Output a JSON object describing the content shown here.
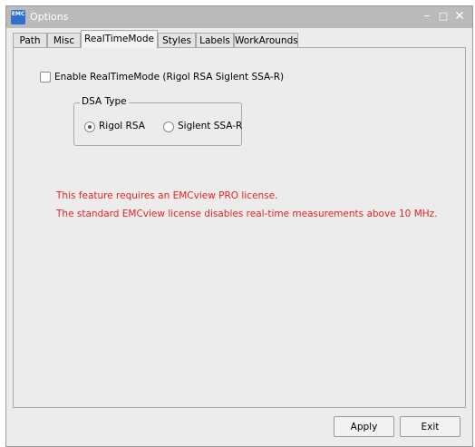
{
  "window": {
    "title": "Options",
    "app_icon_text": "EMC",
    "controls": {
      "minimize": "–",
      "maximize": "□",
      "close": "✕"
    }
  },
  "tabs": [
    {
      "label": "Path"
    },
    {
      "label": "Misc"
    },
    {
      "label": "RealTimeMode",
      "active": true
    },
    {
      "label": "Styles"
    },
    {
      "label": "Labels"
    },
    {
      "label": "WorkArounds"
    }
  ],
  "realtime": {
    "enable_label": "Enable RealTimeMode (Rigol RSA  Siglent SSA-R)",
    "enable_checked": false,
    "dsa_group_title": "DSA Type",
    "dsa_options": [
      {
        "label": "Rigol RSA",
        "selected": true
      },
      {
        "label": "Siglent SSA-R",
        "selected": false
      }
    ],
    "messages": [
      "This feature requires an EMCview PRO license.",
      "The standard EMCview license disables real-time measurements above 10 MHz."
    ],
    "message_color": "#e8231f"
  },
  "footer": {
    "apply_label": "Apply",
    "exit_label": "Exit"
  }
}
